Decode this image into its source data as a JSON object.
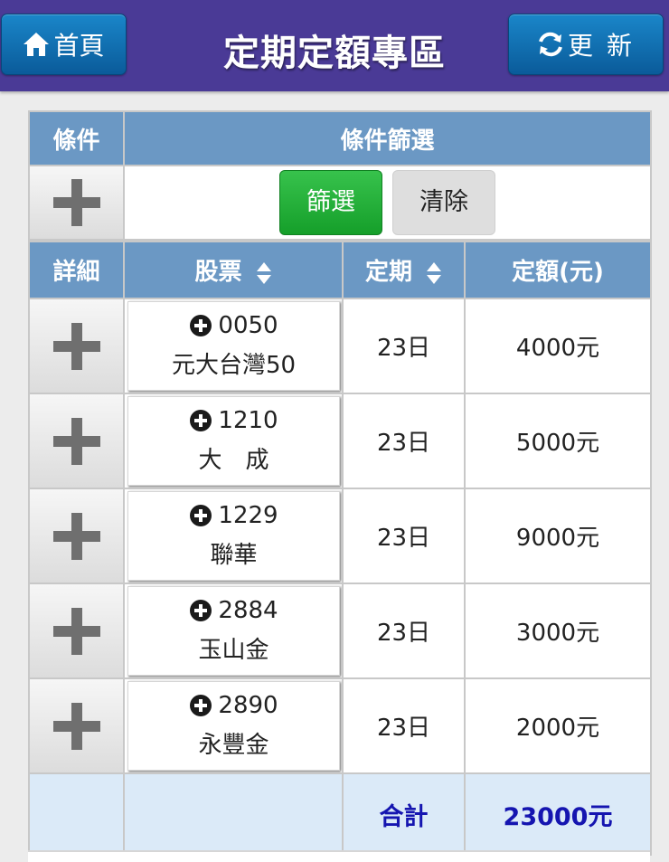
{
  "header": {
    "title": "定期定額專區",
    "home_label": "首頁",
    "refresh_label": "更 新"
  },
  "filter": {
    "cond_header": "條件",
    "filter_header": "條件篩選",
    "apply_label": "篩選",
    "clear_label": "清除"
  },
  "columns": {
    "detail": "詳細",
    "stock": "股票",
    "period": "定期",
    "amount": "定額(元)"
  },
  "rows": [
    {
      "code": "0050",
      "name": "元大台灣50",
      "period": "23日",
      "amount": "4000元"
    },
    {
      "code": "1210",
      "name": "大　成",
      "period": "23日",
      "amount": "5000元"
    },
    {
      "code": "1229",
      "name": "聯華",
      "period": "23日",
      "amount": "9000元"
    },
    {
      "code": "2884",
      "name": "玉山金",
      "period": "23日",
      "amount": "3000元"
    },
    {
      "code": "2890",
      "name": "永豐金",
      "period": "23日",
      "amount": "2000元"
    }
  ],
  "total": {
    "label": "合計",
    "value": "23000元"
  },
  "colors": {
    "topbar": "#4a3a96",
    "nav_button": "#1176bc",
    "header_cell": "#6b98c4",
    "primary_button": "#22ae36",
    "total_text": "#1515b0",
    "total_bg": "#dbeaf8"
  },
  "icons": {
    "home": "home-icon",
    "refresh": "refresh-icon",
    "add": "plus-icon",
    "sort": "sort-icon",
    "stock_add": "plus-circle-icon"
  }
}
